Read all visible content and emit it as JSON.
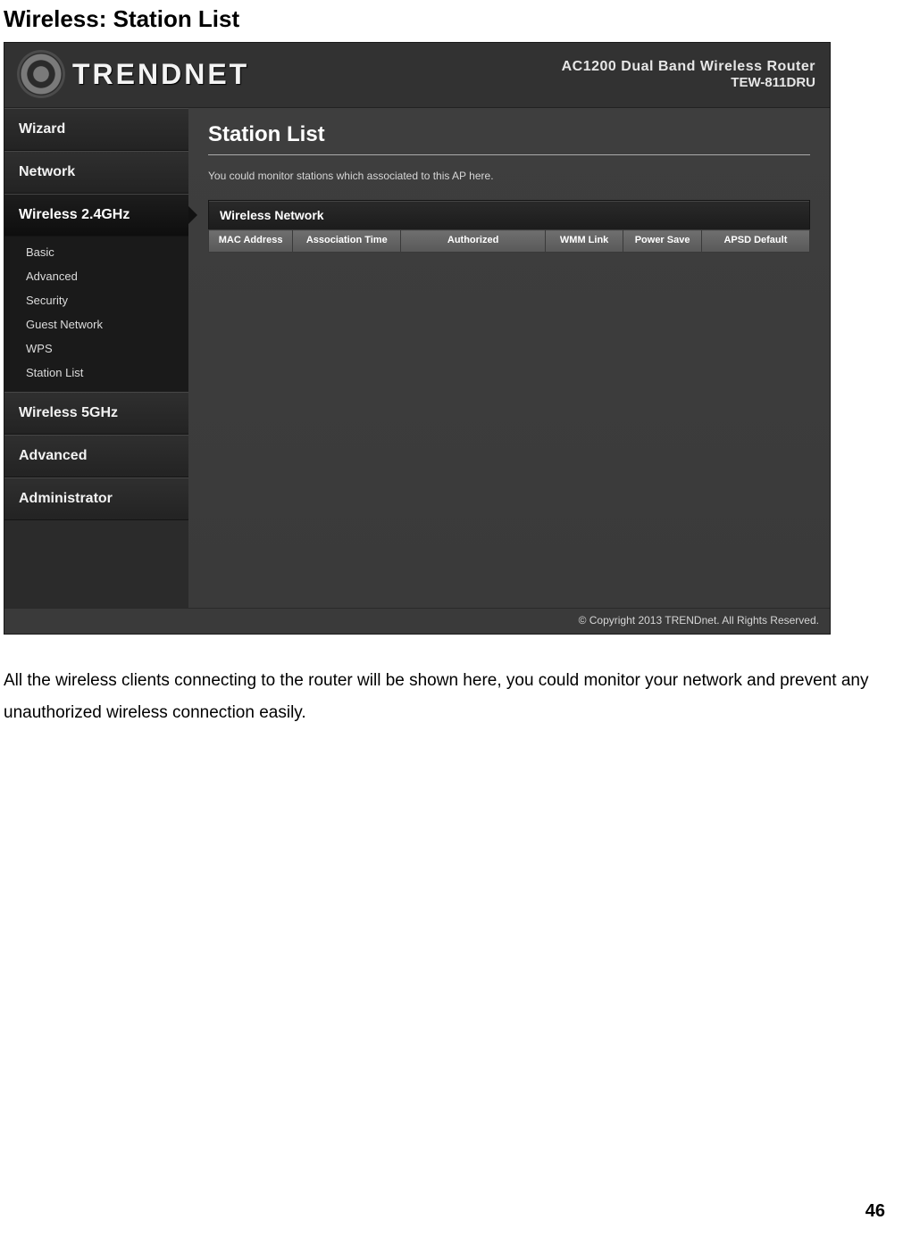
{
  "doc": {
    "section_title": "Wireless: Station List",
    "paragraph": "All the wireless clients connecting to the router will be shown here, you could monitor your network and prevent any unauthorized wireless connection easily.",
    "page_number": "46"
  },
  "header": {
    "brand": "TRENDNET",
    "product_line1": "AC1200 Dual Band Wireless Router",
    "product_line2": "TEW-811DRU"
  },
  "sidebar": {
    "items": [
      {
        "label": "Wizard"
      },
      {
        "label": "Network"
      },
      {
        "label": "Wireless 2.4GHz",
        "active": true
      },
      {
        "label": "Wireless 5GHz"
      },
      {
        "label": "Advanced"
      },
      {
        "label": "Administrator"
      }
    ],
    "w24_sub": [
      {
        "label": "Basic"
      },
      {
        "label": "Advanced"
      },
      {
        "label": "Security"
      },
      {
        "label": "Guest Network"
      },
      {
        "label": "WPS"
      },
      {
        "label": "Station List"
      }
    ]
  },
  "main": {
    "title": "Station List",
    "description": "You could monitor stations which associated to this AP here.",
    "section_label": "Wireless Network",
    "columns": {
      "c0": "MAC Address",
      "c1": "Association Time",
      "c2": "Authorized",
      "c3": "WMM Link",
      "c4": "Power Save",
      "c5": "APSD Default"
    }
  },
  "footer": {
    "copyright": "© Copyright 2013 TRENDnet. All Rights Reserved."
  }
}
